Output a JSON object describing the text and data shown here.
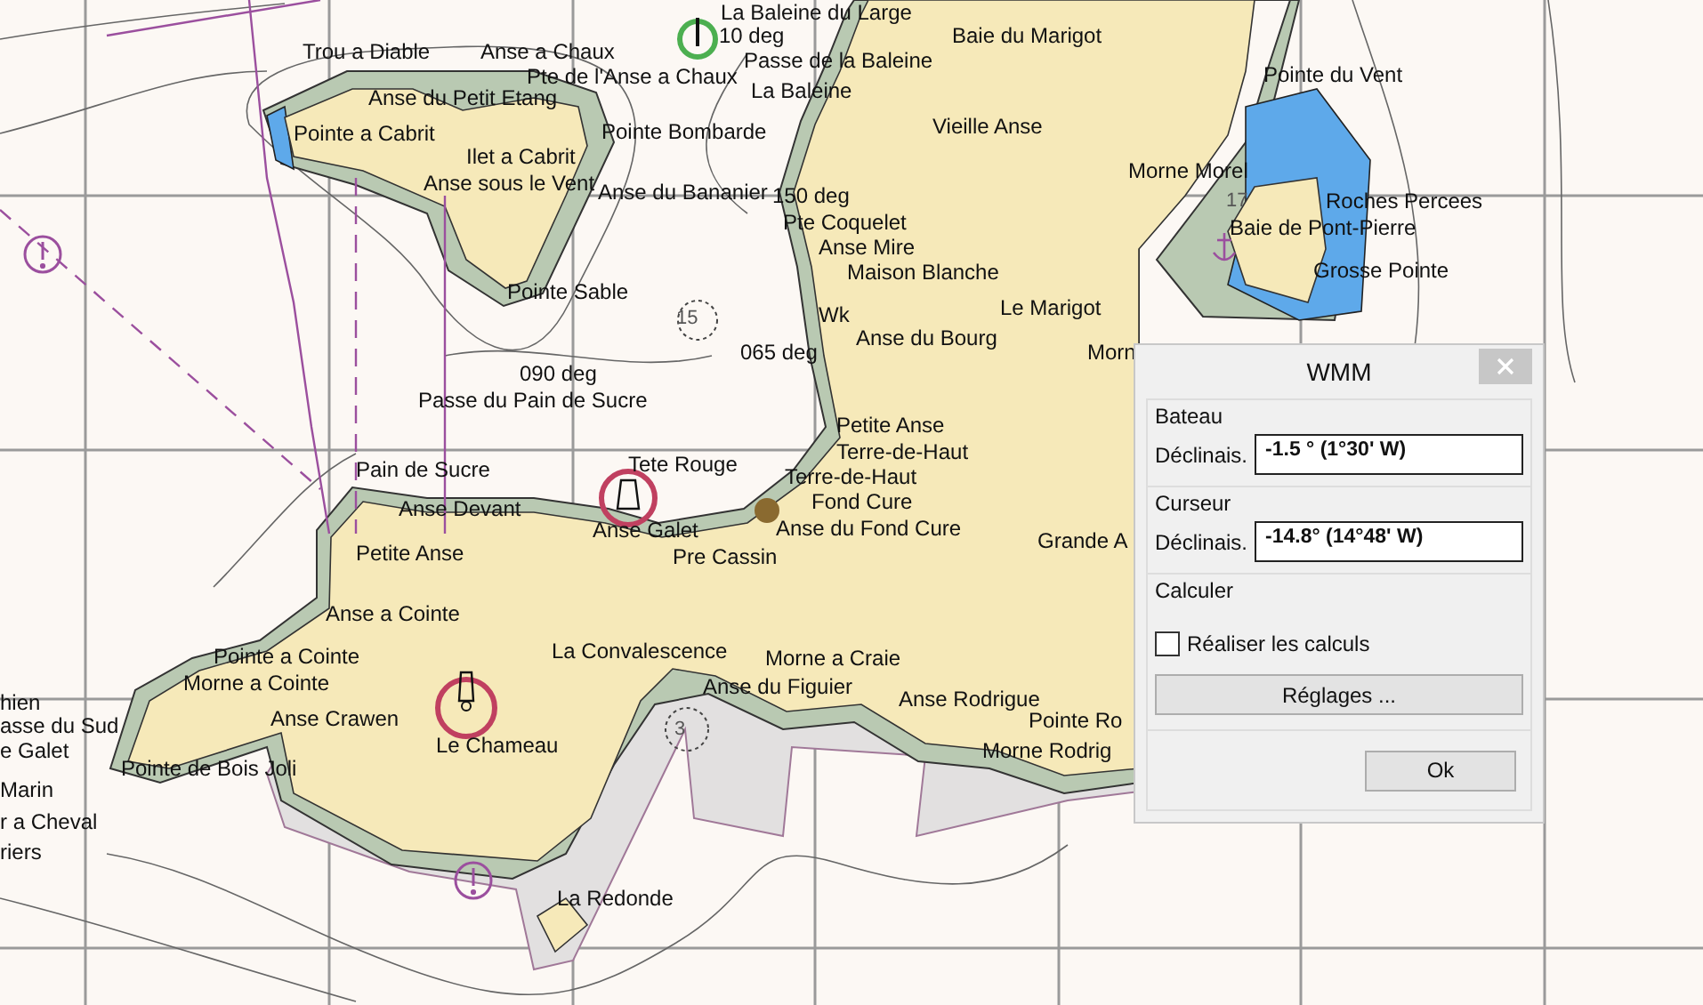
{
  "chart": {
    "labels": [
      "La Baleine du Large",
      "10 deg",
      "Baie du Marigot",
      "Trou a Diable",
      "Anse a Chaux",
      "Passe de la Baleine",
      "Pointe du Vent",
      "Pte de l'Anse a Chaux",
      "La Baleine",
      "Anse du Petit Etang",
      "Pointe a Cabrit",
      "Pointe Bombarde",
      "Vieille Anse",
      "Ilet a Cabrit",
      "Morne Morel",
      "Anse sous le Vent",
      "Anse du Bananier",
      "150 deg",
      "Roches Percees",
      "Pte Coquelet",
      "Baie de Pont-Pierre",
      "Anse Mire",
      "Grosse Pointe",
      "Maison Blanche",
      "Pointe Sable",
      "Le Marigot",
      "Wk",
      "Anse du Bourg",
      "065 deg",
      "Morn",
      "090 deg",
      "Passe du Pain de Sucre",
      "Petite Anse",
      "Terre-de-Haut",
      "Pain de Sucre",
      "Tete Rouge",
      "Terre-de-Haut",
      "Fond Cure",
      "Anse Devant",
      "Anse Galet",
      "Anse du Fond Cure",
      "Grande A",
      "Petite Anse",
      "Pre Cassin",
      "Anse a Cointe",
      "Pointe a Cointe",
      "La Convalescence",
      "Morne a Craie",
      "hien",
      "Morne a Cointe",
      "Anse du Figuier",
      "Anse Rodrigue",
      "asse du Sud",
      "Anse Crawen",
      "Pointe Ro",
      "e Galet",
      "Le Chameau",
      "Morne Rodrig",
      "Pointe de Bois Joli",
      "Marin",
      "r a Cheval",
      "riers",
      "La Redonde"
    ],
    "depth_marks": [
      "15",
      "17",
      "3"
    ]
  },
  "dialog": {
    "title": "WMM",
    "groups": [
      {
        "title": "Bateau",
        "field_label": "Déclinais.",
        "value": "-1.5 ° (1°30' W)"
      },
      {
        "title": "Curseur",
        "field_label": "Déclinais.",
        "value": "-14.8° (14°48' W)"
      }
    ],
    "calc": {
      "title": "Calculer",
      "checkbox_label": "Réaliser les calculs",
      "checked": false,
      "button": "Réglages ..."
    },
    "ok": "Ok"
  }
}
